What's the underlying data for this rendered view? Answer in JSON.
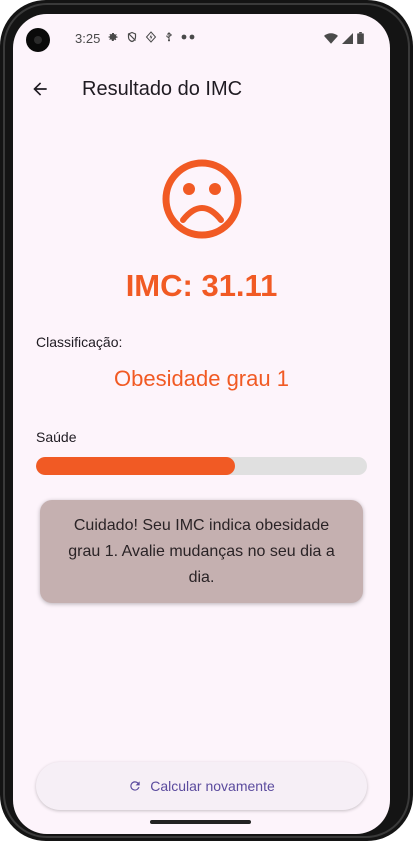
{
  "status_bar": {
    "time": "3:25",
    "left_icons": [
      "settings-icon",
      "shield-icon",
      "signal-bolt-icon",
      "usb-icon",
      "more-dots-icon"
    ],
    "right_icons": [
      "wifi-icon",
      "cellular-icon",
      "battery-icon"
    ]
  },
  "app_bar": {
    "back_icon": "arrow-back-icon",
    "title": "Resultado do IMC"
  },
  "result": {
    "face_icon": "sad-face-icon",
    "imc_text": "IMC: 31.11",
    "classification_label": "Classificação:",
    "classification_value": "Obesidade grau 1",
    "health_label": "Saúde",
    "health_progress": 0.6,
    "alert_text": "Cuidado! Seu IMC indica obesidade grau 1. Avalie mudanças no seu dia a dia."
  },
  "actions": {
    "recalc_icon": "refresh-icon",
    "recalc_label": "Calcular novamente"
  },
  "colors": {
    "accent": "#f15a24",
    "card_background": "#c5b0b0",
    "screen_background": "#fdf4fb",
    "button_text": "#5b4b9e"
  }
}
